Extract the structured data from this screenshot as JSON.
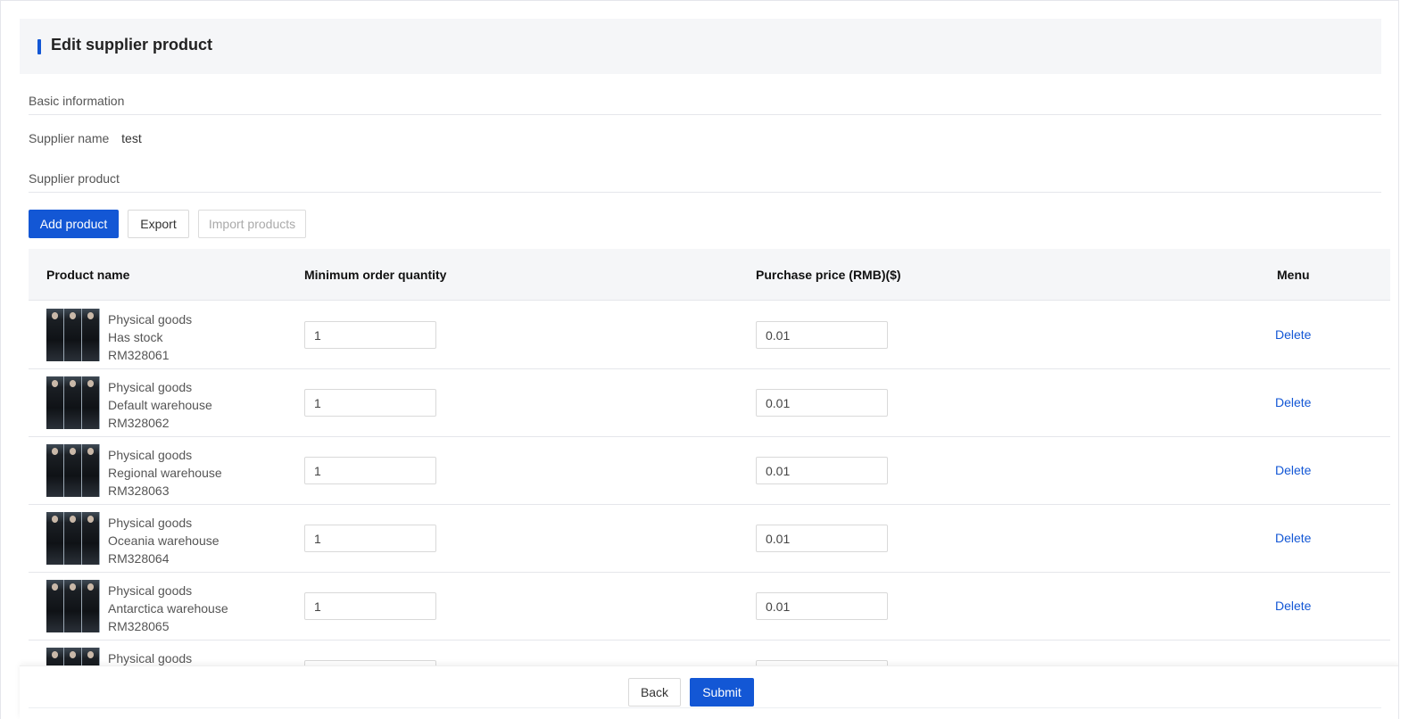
{
  "page": {
    "title": "Edit supplier product"
  },
  "basic": {
    "section_label": "Basic information",
    "supplier_name_label": "Supplier name",
    "supplier_name_value": "test"
  },
  "products_section": {
    "label": "Supplier product"
  },
  "toolbar": {
    "add_label": "Add product",
    "export_label": "Export",
    "import_label": "Import products"
  },
  "table": {
    "columns": [
      "Product name",
      "Minimum order quantity",
      "Purchase price (RMB)($)",
      "Menu"
    ],
    "delete_label": "Delete",
    "rows": [
      {
        "type": "Physical goods",
        "stock": "Has stock",
        "sku": "RM328061",
        "min_qty": "1",
        "price": "0.01"
      },
      {
        "type": "Physical goods",
        "stock": "Default warehouse",
        "sku": "RM328062",
        "min_qty": "1",
        "price": "0.01"
      },
      {
        "type": "Physical goods",
        "stock": "Regional warehouse",
        "sku": "RM328063",
        "min_qty": "1",
        "price": "0.01"
      },
      {
        "type": "Physical goods",
        "stock": "Oceania warehouse",
        "sku": "RM328064",
        "min_qty": "1",
        "price": "0.01"
      },
      {
        "type": "Physical goods",
        "stock": "Antarctica warehouse",
        "sku": "RM328065",
        "min_qty": "1",
        "price": "0.01"
      },
      {
        "type": "Physical goods"
      }
    ]
  },
  "footer": {
    "back_label": "Back",
    "submit_label": "Submit"
  },
  "colors": {
    "accent": "#1357d5",
    "header_bg": "#f5f6f8"
  }
}
